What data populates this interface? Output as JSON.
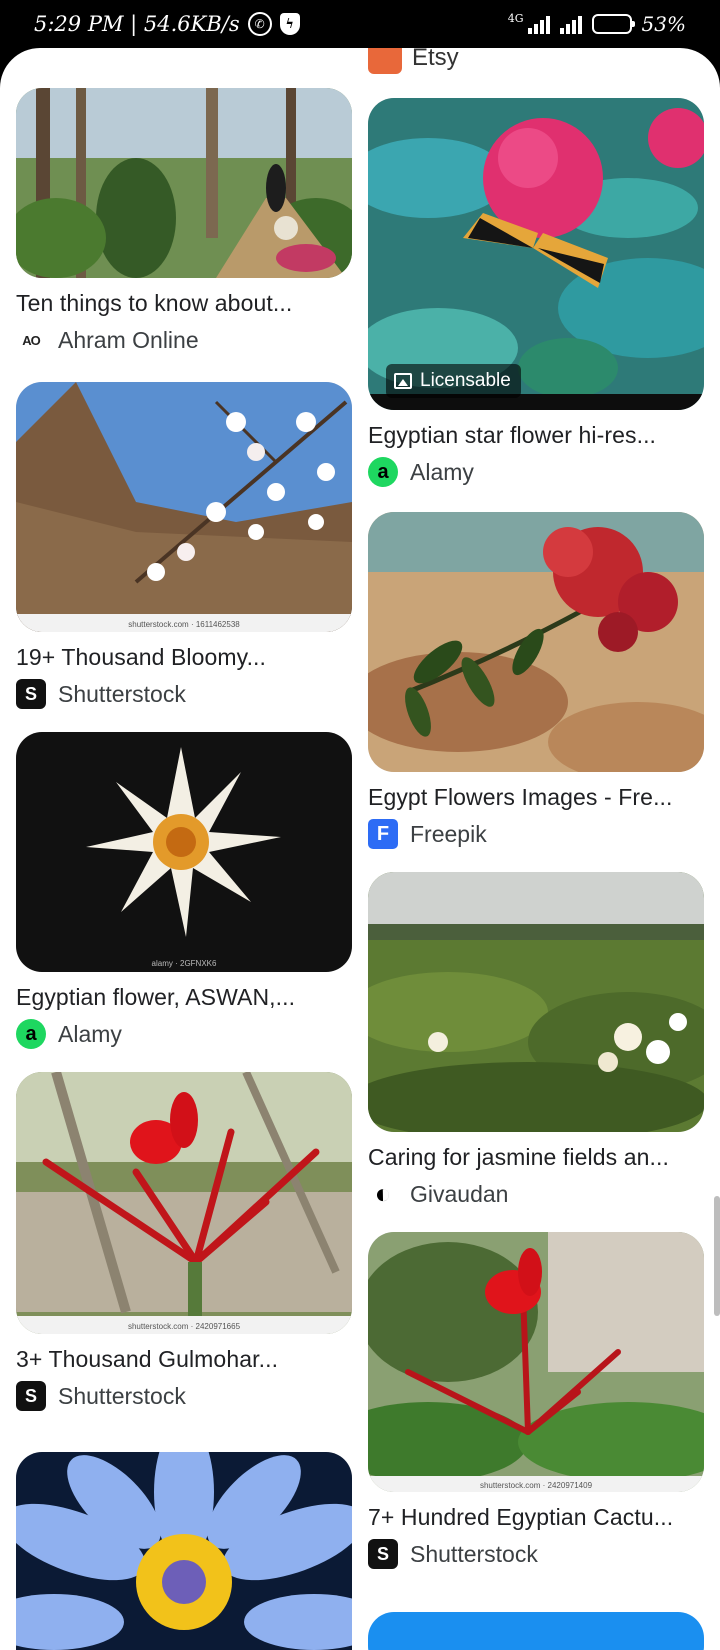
{
  "status_bar": {
    "time_speed": "5:29 PM | 54.6KB/s",
    "network": "4G",
    "battery_percent": "53%",
    "battery_level": 0.53
  },
  "peek_card": {
    "title_fragment": "Etsy"
  },
  "results": [
    {
      "title": "Ten things to know about...",
      "source": "Ahram Online",
      "favicon": "AO"
    },
    {
      "title": "19+ Thousand Bloomy...",
      "source": "Shutterstock",
      "favicon": "S",
      "watermark": "shutterstock.com · 1611462538"
    },
    {
      "title": "Egyptian flower, ASWAN,...",
      "source": "Alamy",
      "favicon": "a",
      "watermark": "alamy · 2GFNXK6"
    },
    {
      "title": "3+ Thousand Gulmohar...",
      "source": "Shutterstock",
      "favicon": "S",
      "watermark": "shutterstock.com · 2420971665"
    },
    {
      "title": "Egyptian star flower hi-res...",
      "source": "Alamy",
      "favicon": "a",
      "badge": "Licensable"
    },
    {
      "title": "Egypt Flowers Images - Fre...",
      "source": "Freepik",
      "favicon": "F"
    },
    {
      "title": "Caring for jasmine fields an...",
      "source": "Givaudan",
      "favicon": "G"
    },
    {
      "title": "7+ Hundred Egyptian Cactu...",
      "source": "Shutterstock",
      "favicon": "S",
      "watermark": "shutterstock.com · 2420971409"
    }
  ]
}
